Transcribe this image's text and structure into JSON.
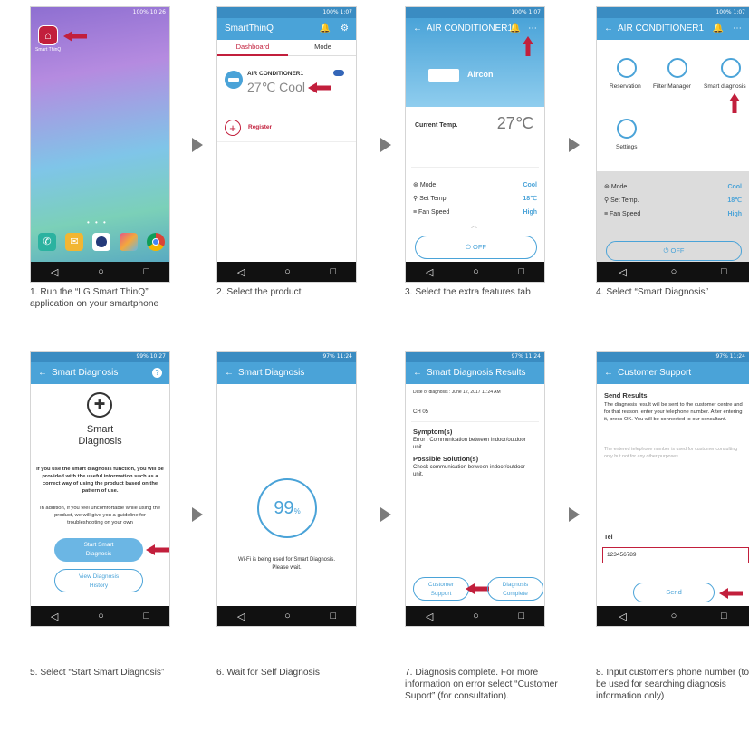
{
  "steps": [
    {
      "caption": "1. Run the “LG Smart ThinQ” application on your smartphone"
    },
    {
      "caption": "2. Select the product"
    },
    {
      "caption": "3. Select the extra features tab"
    },
    {
      "caption": "4. Select “Smart Diagnosis”"
    },
    {
      "caption": "5. Select “Start Smart Diagnosis”"
    },
    {
      "caption": "6. Wait for Self Diagnosis"
    },
    {
      "caption": "7. Diagnosis complete. For more information on error select “Customer Suport” (for consultation)."
    },
    {
      "caption": "8. Input customer's phone number (to be used for searching diagnosis information only)"
    }
  ],
  "status": {
    "s1": "100% 10:26",
    "s2": "100% 1:07",
    "s3": "100% 1:07",
    "s4": "100% 1:07",
    "s5": "99% 10:27",
    "s6": "97% 11:24",
    "s7": "97% 11:24",
    "s8": "97% 11:24"
  },
  "nav": {
    "back": "◁",
    "home": "○",
    "recent": "□"
  },
  "s1": {
    "app_label": "Smart ThinQ"
  },
  "s2": {
    "title": "SmartThinQ",
    "tab_dashboard": "Dashboard",
    "tab_mode": "Mode",
    "device_name": "AIR CONDITIONER1",
    "device_status": "27℃ Cool",
    "register": "Register"
  },
  "s3": {
    "title": "AIR CONDITIONER1",
    "device_label": "Aircon",
    "current_temp_label": "Current Temp.",
    "current_temp_value": "27℃",
    "rows": [
      {
        "label": "Mode",
        "value": "Cool"
      },
      {
        "label": "Set Temp.",
        "value": "18℃"
      },
      {
        "label": "Fan Speed",
        "value": "High"
      }
    ],
    "off": "OFF"
  },
  "s4": {
    "title": "AIR CONDITIONER1",
    "features": [
      "Reservation",
      "Filter Manager",
      "Smart diagnosis",
      "Settings"
    ],
    "rows": [
      {
        "label": "Mode",
        "value": "Cool"
      },
      {
        "label": "Set Temp.",
        "value": "18℃"
      },
      {
        "label": "Fan Speed",
        "value": "High"
      }
    ],
    "off": "OFF"
  },
  "s5": {
    "title": "Smart Diagnosis",
    "logo_line1": "Smart",
    "logo_line2": "Diagnosis",
    "para1": "If you use the smart diagnosis function, you will be provided with the useful information such as a correct way of using the product based on the pattern of use.",
    "para2": "In addition, if you feel uncomfortable while using the product, we will give you a guideline for troubleshooting on your own",
    "start_line1": "Start Smart",
    "start_line2": "Diagnosis",
    "view_line1": "View Diagnosis",
    "view_line2": "History"
  },
  "s6": {
    "title": "Smart Diagnosis",
    "percent": "99",
    "percent_sign": "%",
    "msg1": "Wi-Fi is being used for Smart Diagnosis.",
    "msg2": "Please wait."
  },
  "s7": {
    "title": "Smart Diagnosis Results",
    "date": "Date of diagnosis : June 12, 2017 11:24 AM",
    "code": "CH 05",
    "symptom_h": "Symptom(s)",
    "symptom_t": "Error : Communication between indoor/outdoor unit",
    "solution_h": "Possible Solution(s)",
    "solution_t": "Check communication between indoor/outdoor unit.",
    "support_line1": "Customer",
    "support_line2": "Support",
    "complete_line1": "Diagnosis",
    "complete_line2": "Complete"
  },
  "s8": {
    "title": "Customer Support",
    "send_results": "Send Results",
    "para1": "The diagnosis result will be sent to the customer centre and for that reason, enter your telephone number. After entering it, press OK. You will be connected to our consultant.",
    "para2": "The entered telephone number is used for customer consulting only but not for any other purposes.",
    "tel_label": "Tel",
    "tel_value": "123456789",
    "send": "Send"
  },
  "colors": {
    "accent": "#4aa3d8",
    "red": "#c21f3c",
    "arrow_gray": "#7b7b7b"
  }
}
